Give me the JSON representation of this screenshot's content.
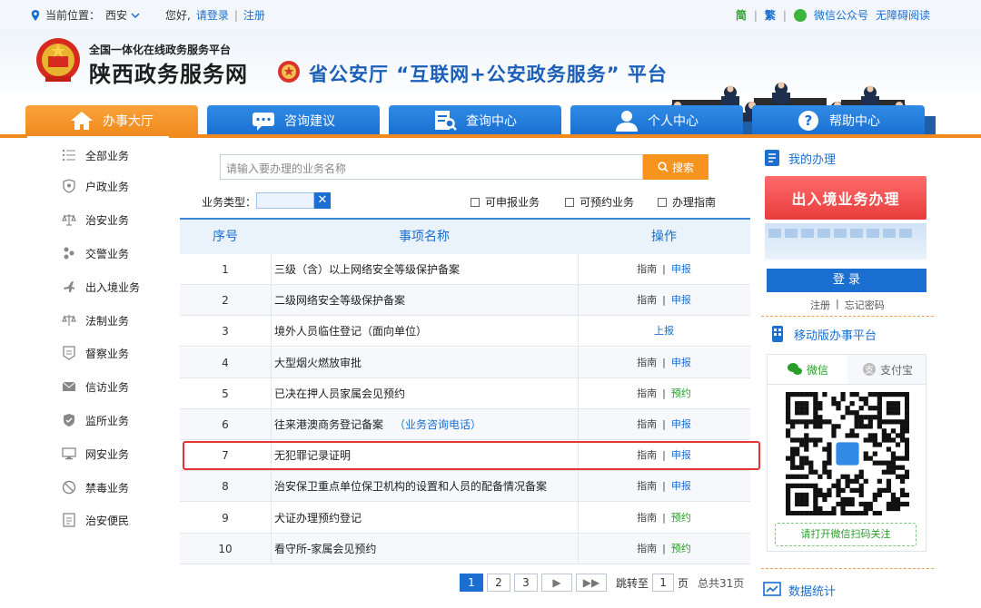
{
  "topbar": {
    "location_label": "当前位置：",
    "city": "西安",
    "greeting": "您好,",
    "login": "请登录",
    "divider": "|",
    "register": "注册",
    "simplified": "简",
    "traditional": "繁",
    "wechat_account": "微信公众号",
    "accessibility": "无障碍阅读"
  },
  "header": {
    "subtitle": "全国一体化在线政务服务平台",
    "title": "陕西政务服务网",
    "platform": "省公安厅 “互联网+公安政务服务” 平台"
  },
  "nav": {
    "tabs": [
      {
        "label": "办事大厅",
        "icon": "home-icon",
        "active": true
      },
      {
        "label": "咨询建议",
        "icon": "chat-icon",
        "active": false
      },
      {
        "label": "查询中心",
        "icon": "search-doc-icon",
        "active": false
      },
      {
        "label": "个人中心",
        "icon": "user-icon",
        "active": false
      },
      {
        "label": "帮助中心",
        "icon": "help-icon",
        "active": false
      }
    ]
  },
  "sidebar": {
    "items": [
      {
        "label": "全部业务",
        "icon": "list-icon"
      },
      {
        "label": "户政业务",
        "icon": "shield-icon"
      },
      {
        "label": "治安业务",
        "icon": "scale-icon"
      },
      {
        "label": "交警业务",
        "icon": "traffic-icon"
      },
      {
        "label": "出入境业务",
        "icon": "plane-icon"
      },
      {
        "label": "法制业务",
        "icon": "law-icon"
      },
      {
        "label": "督察业务",
        "icon": "badge-icon"
      },
      {
        "label": "信访业务",
        "icon": "mail-icon"
      },
      {
        "label": "监所业务",
        "icon": "shield-check-icon"
      },
      {
        "label": "网安业务",
        "icon": "monitor-icon"
      },
      {
        "label": "禁毒业务",
        "icon": "no-drug-icon"
      },
      {
        "label": "治安便民",
        "icon": "service-icon"
      }
    ]
  },
  "search": {
    "placeholder": "请输入要办理的业务名称",
    "button": "搜索",
    "biz_type_label": "业务类型：",
    "clear": "✕",
    "filters": [
      "可申报业务",
      "可预约业务",
      "办理指南"
    ]
  },
  "table": {
    "headers": {
      "no": "序号",
      "name": "事项名称",
      "op": "操作"
    },
    "rows": [
      {
        "no": "1",
        "name": "三级（含）以上网络安全等级保护备案",
        "extra": "",
        "ops": [
          "指南",
          "|",
          "申报"
        ]
      },
      {
        "no": "2",
        "name": "二级网络安全等级保护备案",
        "extra": "",
        "ops": [
          "指南",
          "|",
          "申报"
        ]
      },
      {
        "no": "3",
        "name": "境外人员临住登记（面向单位）",
        "extra": "",
        "ops": [
          "",
          "",
          "上报"
        ]
      },
      {
        "no": "4",
        "name": "大型烟火燃放审批",
        "extra": "",
        "ops": [
          "指南",
          "|",
          "申报"
        ]
      },
      {
        "no": "5",
        "name": "已决在押人员家属会见预约",
        "extra": "",
        "ops": [
          "指南",
          "|",
          "预约"
        ]
      },
      {
        "no": "6",
        "name": "往来港澳商务登记备案",
        "extra": "（业务咨询电话）",
        "ops": [
          "指南",
          "|",
          "申报"
        ]
      },
      {
        "no": "7",
        "name": "无犯罪记录证明",
        "extra": "",
        "ops": [
          "指南",
          "|",
          "申报"
        ]
      },
      {
        "no": "8",
        "name": "治安保卫重点单位保卫机构的设置和人员的配备情况备案",
        "extra": "",
        "ops": [
          "指南",
          "|",
          "申报"
        ]
      },
      {
        "no": "9",
        "name": "犬证办理预约登记",
        "extra": "",
        "ops": [
          "指南",
          "|",
          "预约"
        ]
      },
      {
        "no": "10",
        "name": "看守所-家属会见预约",
        "extra": "",
        "ops": [
          "指南",
          "|",
          "预约"
        ]
      }
    ]
  },
  "pager": {
    "pages": [
      "1",
      "2",
      "3"
    ],
    "current": "1",
    "next": "▶",
    "last": "▶▶",
    "jump_label": "跳转至",
    "jump_value": "1",
    "page_unit": "页",
    "total": "总共31页"
  },
  "right": {
    "my_affairs": "我的办理",
    "banner": "出入境业务办理",
    "login": "登 录",
    "register": "注册",
    "divider": "|",
    "forgot": "忘记密码",
    "mobile_title": "移动版办事平台",
    "tab_wechat": "微信",
    "tab_alipay": "支付宝",
    "qr_caption": "请打开微信扫码关注",
    "stats_title": "数据统计"
  },
  "colors": {
    "brand_blue": "#1a6fd1",
    "nav_orange": "#f08a1e",
    "highlight_red": "#e53434",
    "success_green": "#2a9d2a"
  }
}
